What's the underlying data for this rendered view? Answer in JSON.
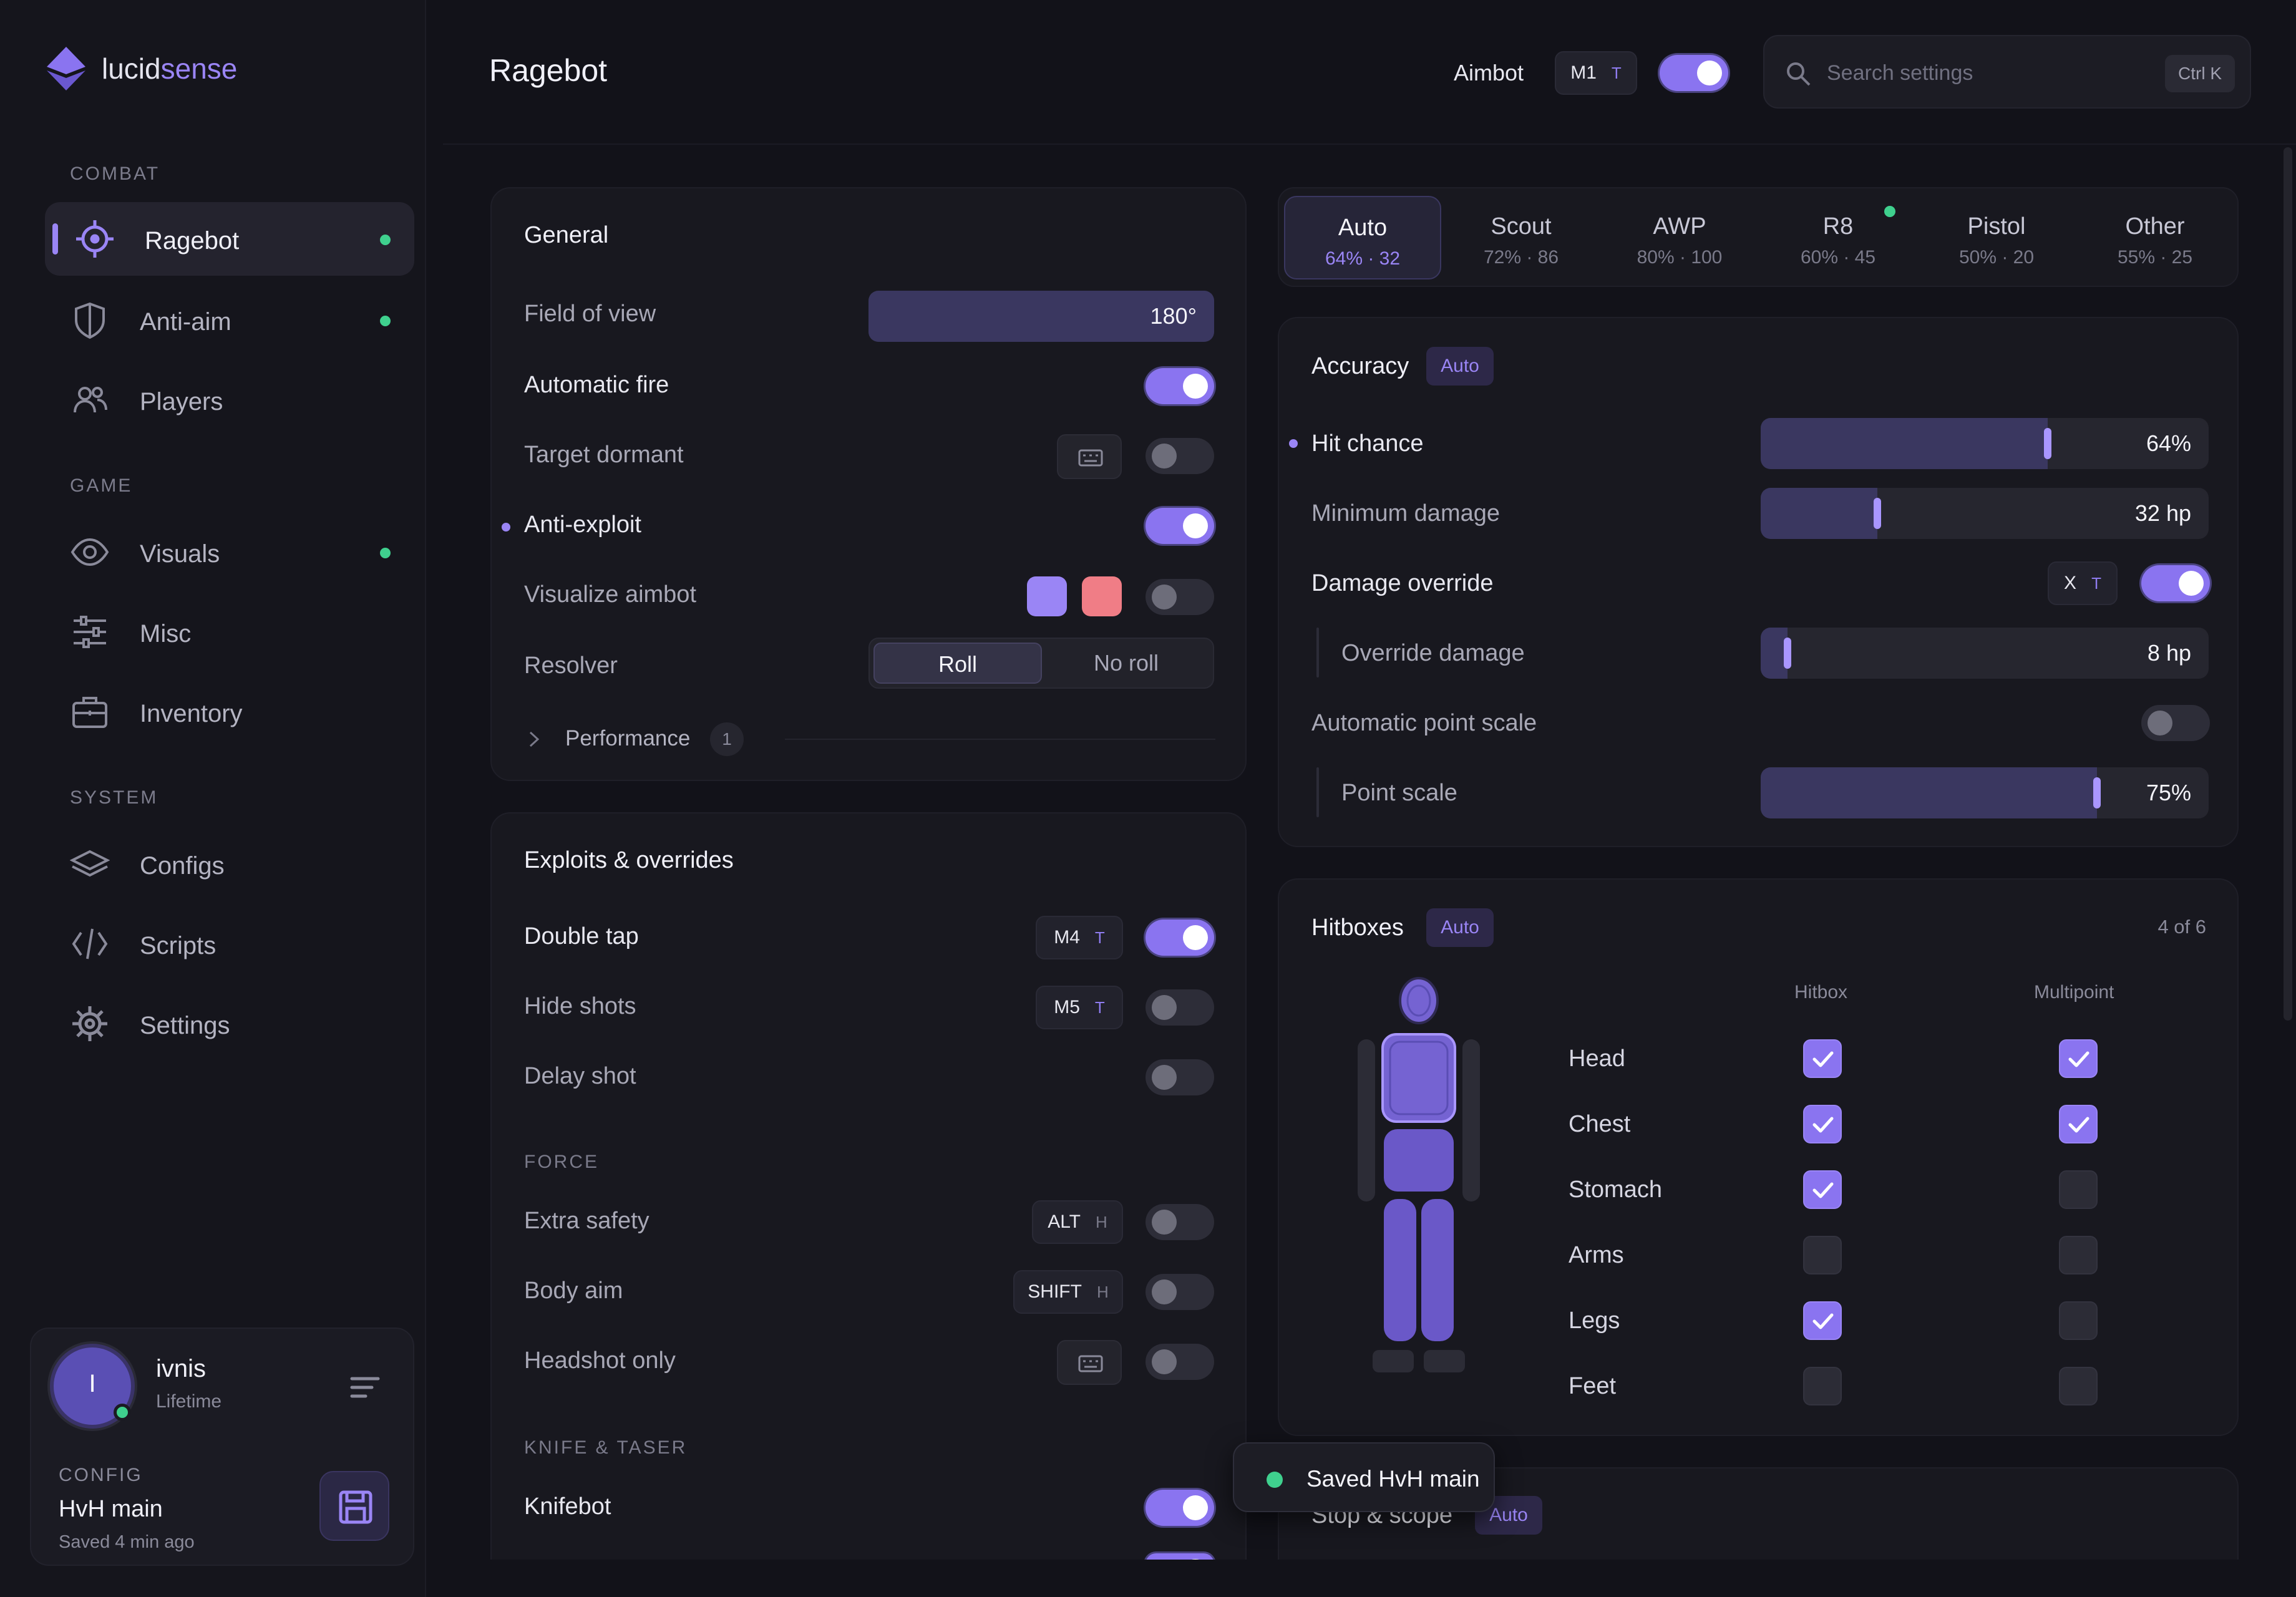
{
  "brand": {
    "name_a": "lucid",
    "name_b": "sense"
  },
  "sidebar": {
    "sections": [
      "COMBAT",
      "GAME",
      "SYSTEM"
    ],
    "items": [
      {
        "label": "Ragebot",
        "icon": "crosshair-icon",
        "active": true,
        "dot": true
      },
      {
        "label": "Anti-aim",
        "icon": "shield-icon",
        "dot": true
      },
      {
        "label": "Players",
        "icon": "users-icon",
        "dot": false
      },
      {
        "label": "Visuals",
        "icon": "eye-icon",
        "dot": true
      },
      {
        "label": "Misc",
        "icon": "sliders-icon",
        "dot": false
      },
      {
        "label": "Inventory",
        "icon": "briefcase-icon",
        "dot": false
      },
      {
        "label": "Configs",
        "icon": "layers-icon",
        "dot": false
      },
      {
        "label": "Scripts",
        "icon": "code-icon",
        "dot": false
      },
      {
        "label": "Settings",
        "icon": "gear-icon",
        "dot": false
      }
    ]
  },
  "user": {
    "initial": "I",
    "name": "ivnis",
    "tier": "Lifetime",
    "config_label": "CONFIG",
    "config_name": "HvH main",
    "config_saved": "Saved 4 min ago"
  },
  "header": {
    "title": "Ragebot",
    "aimbot_label": "Aimbot",
    "aimbot_key": "M1",
    "aimbot_key_mode": "T",
    "aimbot_enabled": true,
    "search_placeholder": "Search settings",
    "search_shortcut": "Ctrl K"
  },
  "general": {
    "title": "General",
    "fov_label": "Field of view",
    "fov_value": "180°",
    "fov_fraction": 1.0,
    "auto_fire_label": "Automatic fire",
    "auto_fire": true,
    "target_dormant_label": "Target dormant",
    "target_dormant": false,
    "anti_exploit_label": "Anti-exploit",
    "anti_exploit": true,
    "visualize_label": "Visualize aimbot",
    "visualize": false,
    "visualize_colors": [
      "#9a85f5",
      "#f07d86"
    ],
    "resolver_label": "Resolver",
    "resolver_options": [
      "Roll",
      "No roll"
    ],
    "resolver_selected": "Roll",
    "performance_label": "Performance",
    "performance_count": "1"
  },
  "exploits": {
    "title": "Exploits & overrides",
    "double_tap_label": "Double tap",
    "double_tap_key": "M4",
    "double_tap_mode": "T",
    "double_tap": true,
    "hide_shots_label": "Hide shots",
    "hide_shots_key": "M5",
    "hide_shots_mode": "T",
    "hide_shots": false,
    "delay_shot_label": "Delay shot",
    "delay_shot": false,
    "force_group": "FORCE",
    "extra_safety_label": "Extra safety",
    "extra_safety_key": "ALT",
    "extra_safety_mode": "H",
    "extra_safety": false,
    "body_aim_label": "Body aim",
    "body_aim_key": "SHIFT",
    "body_aim_mode": "H",
    "body_aim": false,
    "headshot_label": "Headshot only",
    "headshot": false,
    "knife_group": "KNIFE & TASER",
    "knifebot_label": "Knifebot",
    "knifebot": true
  },
  "weapon_tabs": [
    {
      "name": "Auto",
      "sub": "64% · 32",
      "active": true
    },
    {
      "name": "Scout",
      "sub": "72% · 86"
    },
    {
      "name": "AWP",
      "sub": "80% · 100"
    },
    {
      "name": "R8",
      "sub": "60% · 45",
      "dot": true
    },
    {
      "name": "Pistol",
      "sub": "50% · 20"
    },
    {
      "name": "Other",
      "sub": "55% · 25"
    }
  ],
  "accuracy": {
    "title": "Accuracy",
    "chip": "Auto",
    "hit_chance_label": "Hit chance",
    "hit_chance_value": "64%",
    "hit_chance_fraction": 0.64,
    "min_damage_label": "Minimum damage",
    "min_damage_value": "32 hp",
    "min_damage_fraction": 0.26,
    "dmg_override_label": "Damage override",
    "dmg_override_key": "X",
    "dmg_override_mode": "T",
    "dmg_override": true,
    "override_dmg_label": "Override damage",
    "override_dmg_value": "8 hp",
    "override_dmg_fraction": 0.06,
    "auto_point_label": "Automatic point scale",
    "auto_point": false,
    "point_scale_label": "Point scale",
    "point_scale_value": "75%",
    "point_scale_fraction": 0.75
  },
  "hitboxes": {
    "title": "Hitboxes",
    "chip": "Auto",
    "count": "4 of 6",
    "col_hitbox": "Hitbox",
    "col_multipoint": "Multipoint",
    "rows": [
      {
        "name": "Head",
        "hitbox": true,
        "multipoint": true
      },
      {
        "name": "Chest",
        "hitbox": true,
        "multipoint": true
      },
      {
        "name": "Stomach",
        "hitbox": true,
        "multipoint": false
      },
      {
        "name": "Arms",
        "hitbox": false,
        "multipoint": false
      },
      {
        "name": "Legs",
        "hitbox": true,
        "multipoint": false
      },
      {
        "name": "Feet",
        "hitbox": false,
        "multipoint": false
      }
    ]
  },
  "stop_scope": {
    "title": "Stop & scope",
    "chip": "Auto"
  },
  "toast": {
    "text": "Saved HvH main"
  },
  "colors": {
    "accent": "#8a74f0",
    "online": "#3fd08e",
    "bg": "#121219"
  }
}
